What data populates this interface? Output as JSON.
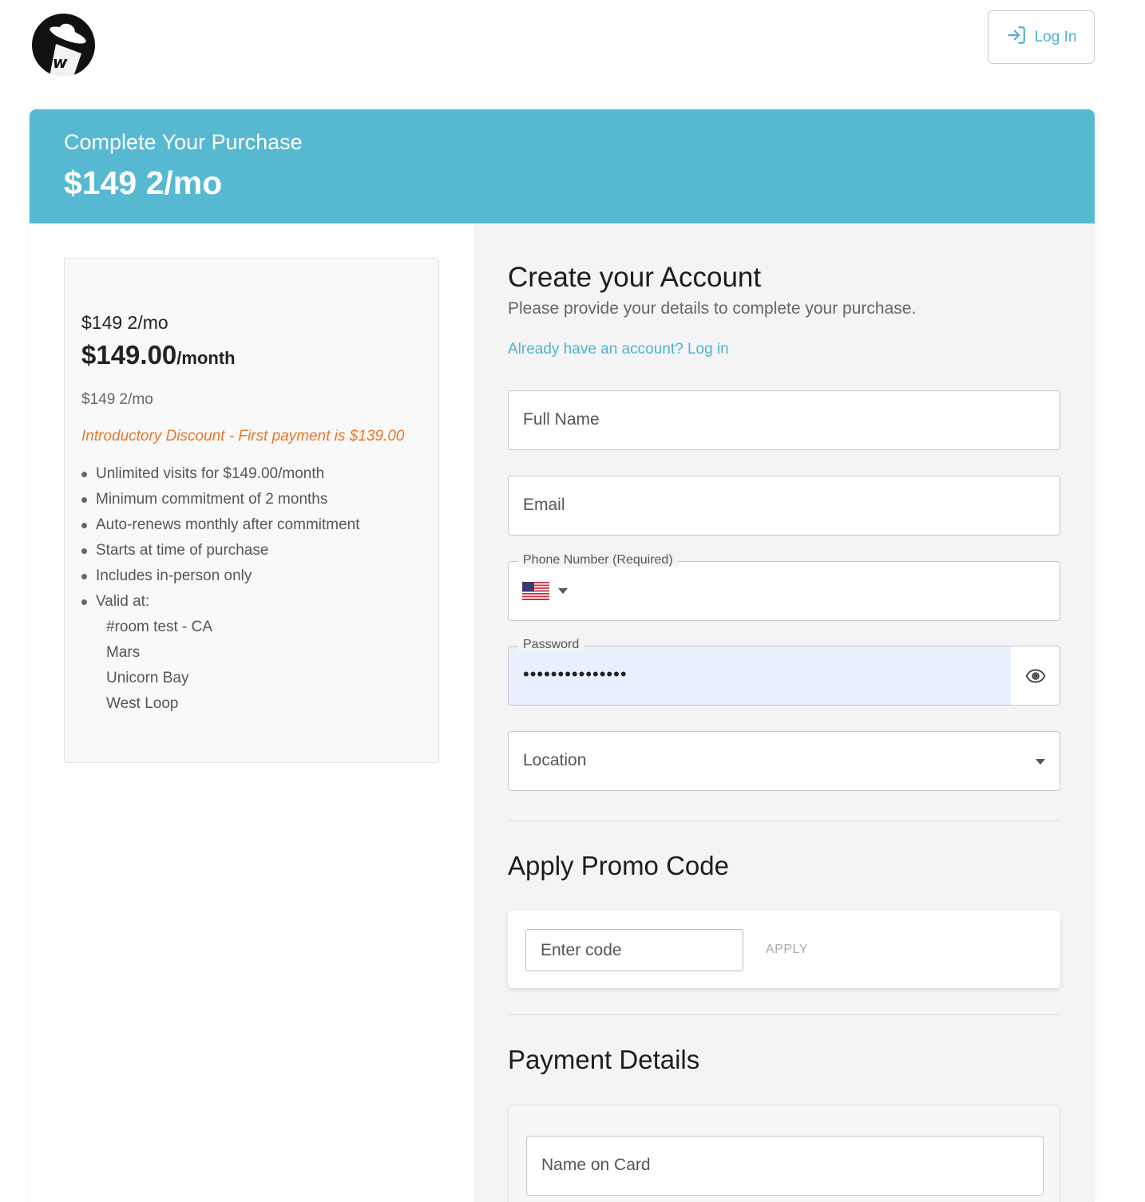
{
  "header": {
    "login_label": "Log In",
    "logo_letter": "w"
  },
  "banner": {
    "title": "Complete Your Purchase",
    "price": "$149 2/mo"
  },
  "plan": {
    "name": "$149 2/mo",
    "price_amount": "$149.00",
    "price_period": "/month",
    "sub_label": "$149 2/mo",
    "discount": "Introductory Discount - First payment is $139.00",
    "features": [
      "Unlimited visits for $149.00/month",
      "Minimum commitment of 2 months",
      "Auto-renews monthly after commitment",
      "Starts at time of purchase",
      "Includes in-person only",
      "Valid at:"
    ],
    "locations": [
      "#room test - CA",
      "Mars",
      "Unicorn Bay",
      "West Loop"
    ]
  },
  "account": {
    "title": "Create your Account",
    "subtitle": "Please provide your details to complete your purchase.",
    "login_link": "Already have an account? Log in",
    "full_name_placeholder": "Full Name",
    "email_placeholder": "Email",
    "phone_legend": "Phone Number (Required)",
    "password_legend": "Password",
    "password_value": "•••••••••••••••",
    "location_placeholder": "Location"
  },
  "promo": {
    "title": "Apply Promo Code",
    "input_placeholder": "Enter code",
    "apply_label": "APPLY"
  },
  "payment": {
    "title": "Payment Details",
    "name_on_card_placeholder": "Name on Card"
  },
  "colors": {
    "accent": "#57b8d2",
    "link": "#4fb3cf",
    "discount": "#e8762b",
    "autofill": "#e8f0fe"
  }
}
